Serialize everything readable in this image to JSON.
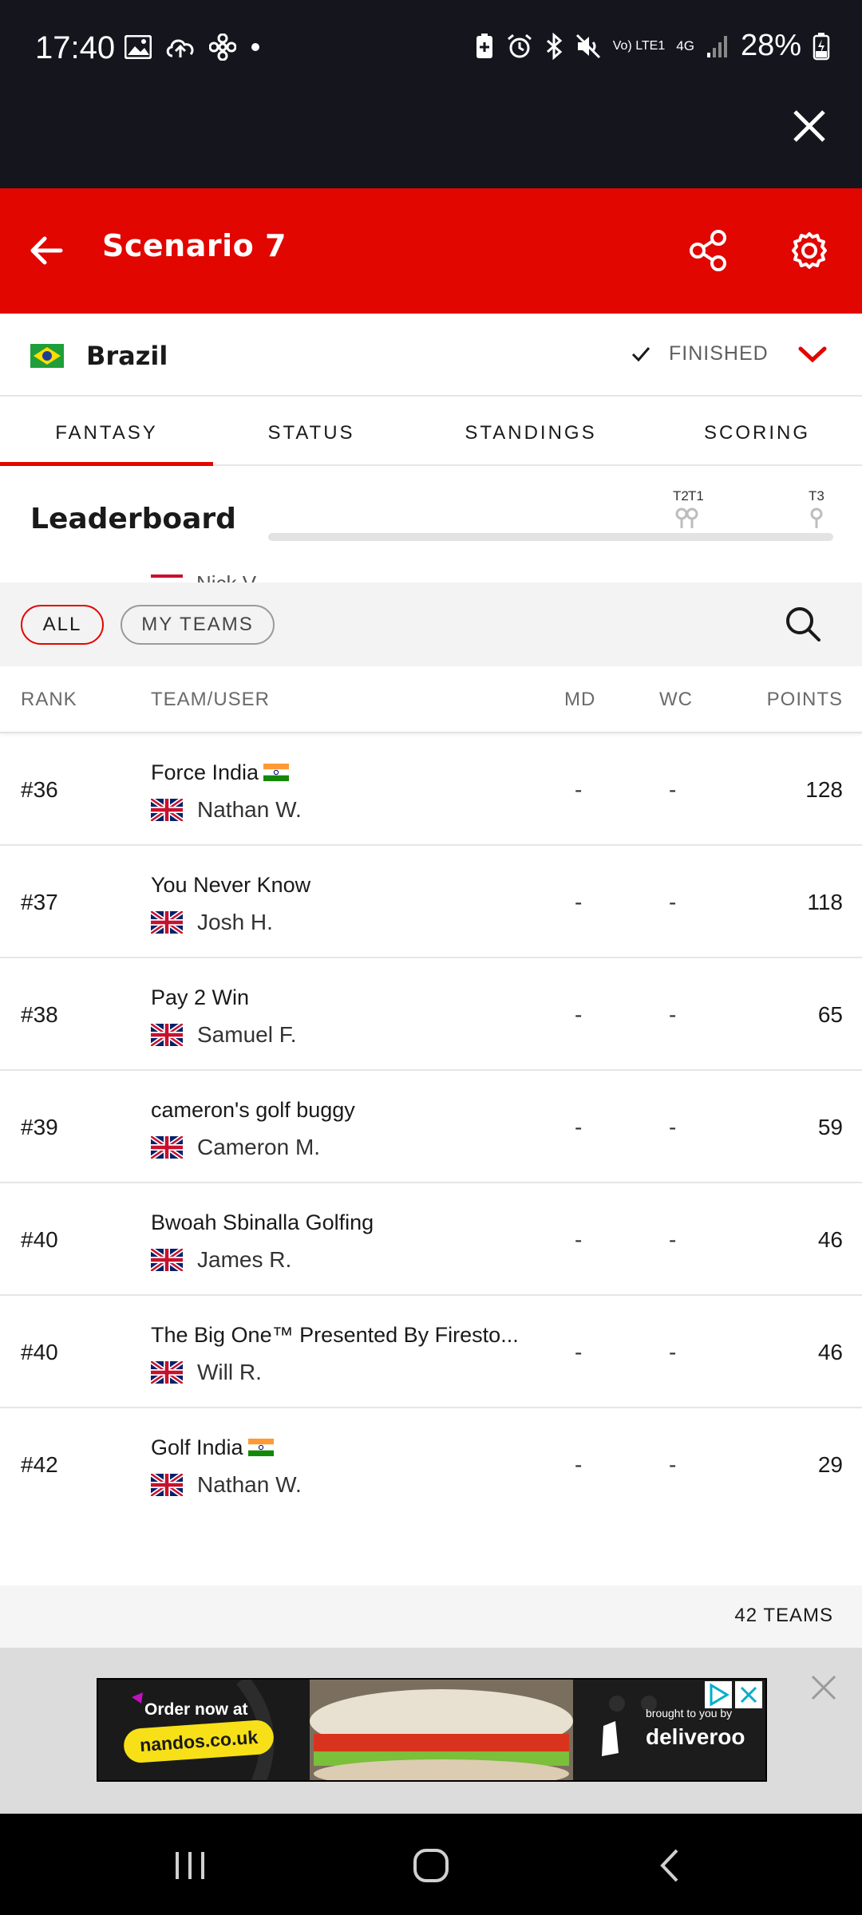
{
  "status_bar": {
    "time": "17:40",
    "battery": "28%",
    "network_volte": "Vo) LTE1",
    "network_4g": "4G"
  },
  "header": {
    "title": "Scenario 7",
    "background_color": "#e10600"
  },
  "race": {
    "name": "Brazil",
    "status": "FINISHED"
  },
  "tabs": [
    {
      "label": "FANTASY",
      "active": true
    },
    {
      "label": "STATUS",
      "active": false
    },
    {
      "label": "STANDINGS",
      "active": false
    },
    {
      "label": "SCORING",
      "active": false
    }
  ],
  "leaderboard": {
    "title": "Leaderboard",
    "timeline_labels": [
      "T2",
      "T1",
      "T3"
    ],
    "peek_text": "Nick V"
  },
  "filters": {
    "all_label": "ALL",
    "my_teams_label": "MY TEAMS"
  },
  "table": {
    "headers": {
      "rank": "RANK",
      "team": "TEAM/USER",
      "md": "MD",
      "wc": "WC",
      "points": "POINTS"
    },
    "rows": [
      {
        "rank": "#36",
        "team": "Force India",
        "india_flag": true,
        "user": "Nathan W.",
        "md": "-",
        "wc": "-",
        "points": "128"
      },
      {
        "rank": "#37",
        "team": "You Never Know",
        "india_flag": false,
        "user": "Josh H.",
        "md": "-",
        "wc": "-",
        "points": "118"
      },
      {
        "rank": "#38",
        "team": "Pay 2 Win",
        "india_flag": false,
        "user": "Samuel F.",
        "md": "-",
        "wc": "-",
        "points": "65"
      },
      {
        "rank": "#39",
        "team": "cameron's golf buggy",
        "india_flag": false,
        "user": "Cameron M.",
        "md": "-",
        "wc": "-",
        "points": "59"
      },
      {
        "rank": "#40",
        "team": "Bwoah Sbinalla Golfing",
        "india_flag": false,
        "user": "James R.",
        "md": "-",
        "wc": "-",
        "points": "46"
      },
      {
        "rank": "#40",
        "team": "The Big One™ Presented By Firesto...",
        "india_flag": false,
        "user": "Will R.",
        "md": "-",
        "wc": "-",
        "points": "46"
      },
      {
        "rank": "#42",
        "team": "Golf India",
        "india_flag": true,
        "user": "Nathan W.",
        "md": "-",
        "wc": "-",
        "points": "29"
      }
    ],
    "total": "42 TEAMS"
  },
  "ad": {
    "order_text": "Order now at",
    "url_text": "nandos.co.uk",
    "brought_text": "brought to you by",
    "brand_text": "deliveroo"
  }
}
